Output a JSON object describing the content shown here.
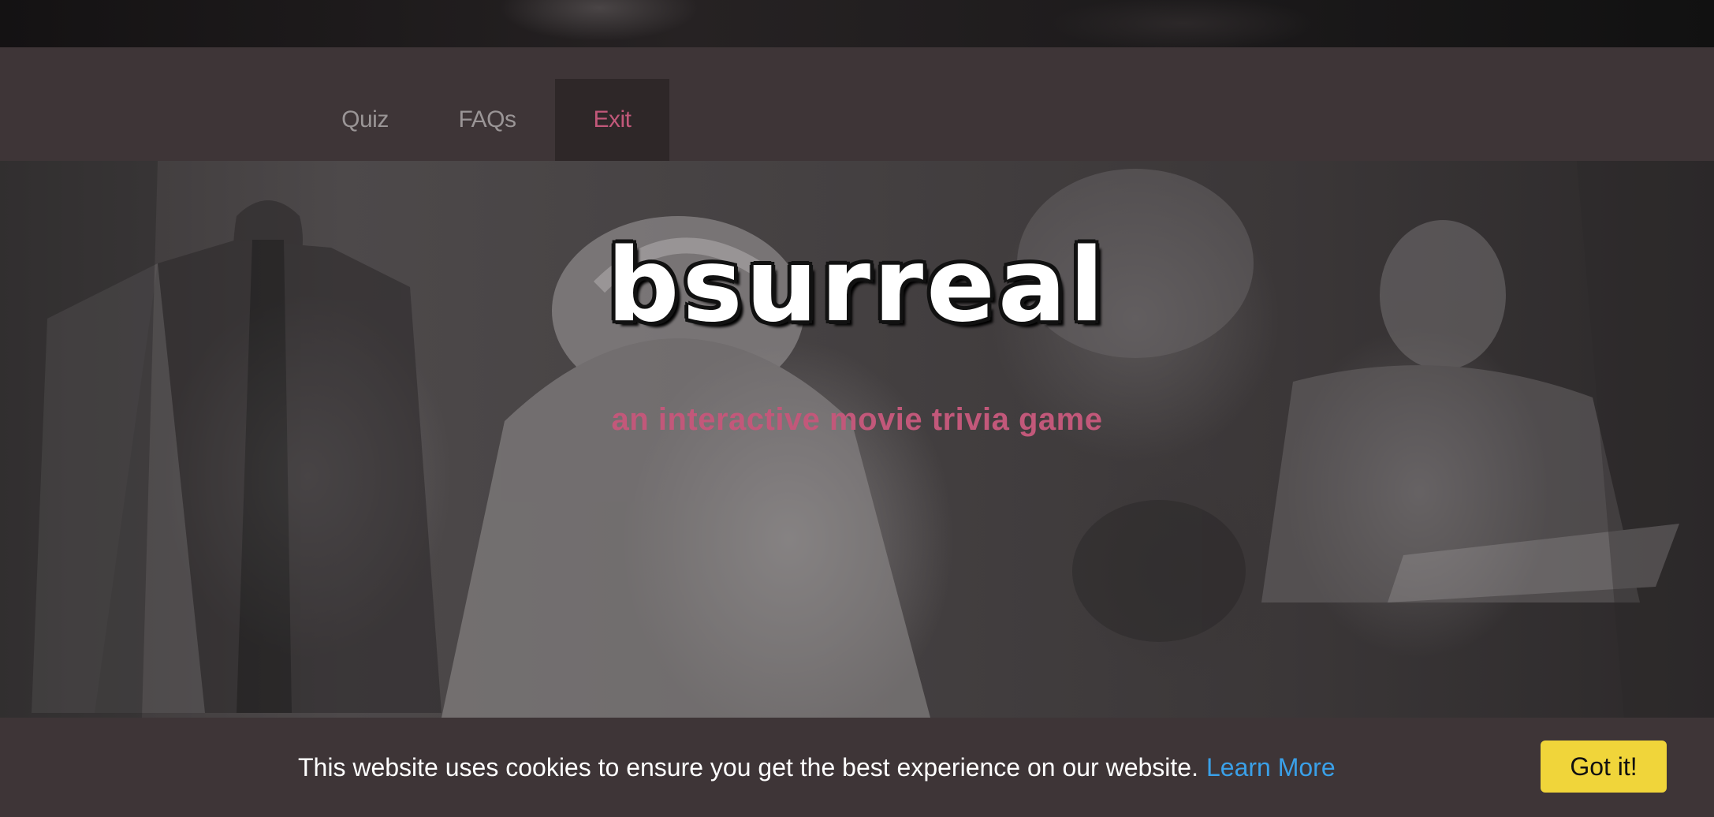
{
  "nav": {
    "items": [
      {
        "label": "Quiz"
      },
      {
        "label": "FAQs"
      },
      {
        "label": "Exit"
      }
    ],
    "active_color": "#c2587a"
  },
  "hero": {
    "logo": "bsurreal",
    "tagline": "an interactive movie trivia game",
    "background": "collage-of-black-and-white-film-stills"
  },
  "cookie": {
    "message": "This website uses cookies to ensure you get the best experience on our website.",
    "link_label": "Learn More",
    "button_label": "Got it!",
    "button_color": "#f0d53a",
    "link_color": "#3aa0e8"
  }
}
